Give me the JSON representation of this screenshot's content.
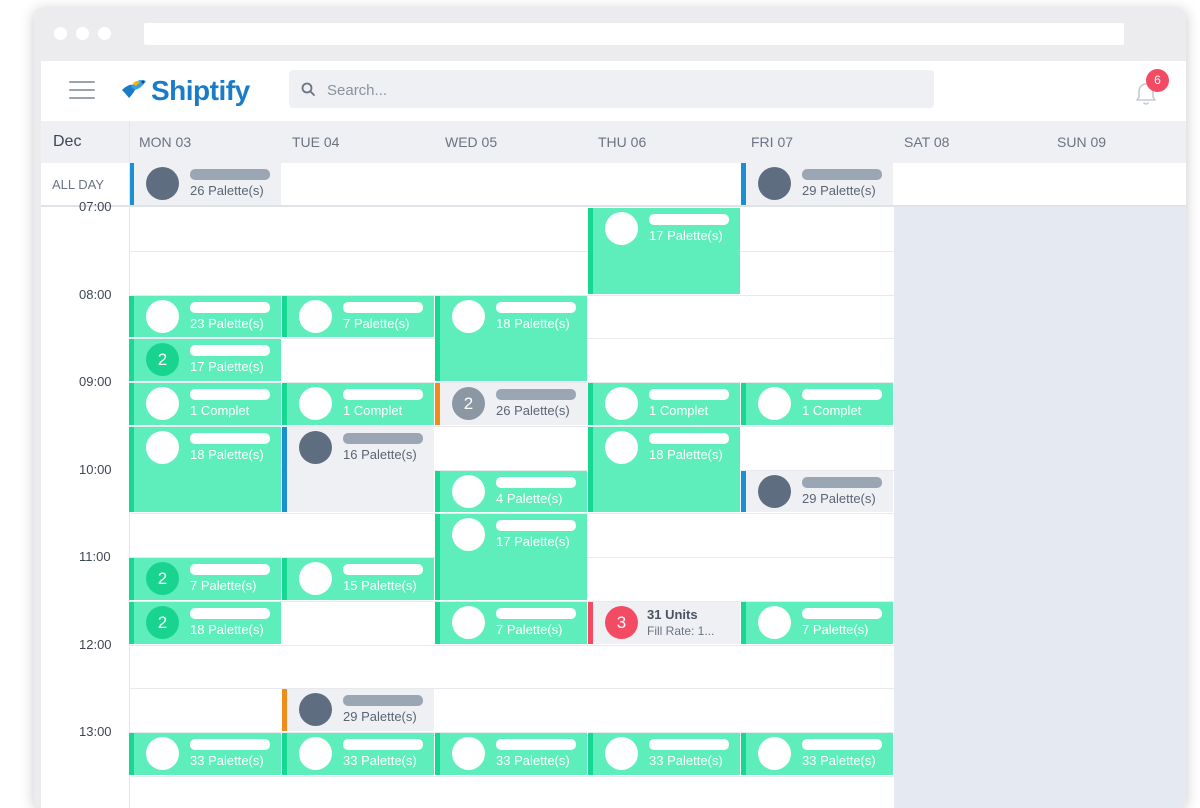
{
  "app": {
    "logo_text": "Shiptify",
    "search_placeholder": "Search...",
    "notifications_count": "6"
  },
  "calendar": {
    "month": "Dec",
    "all_day_label": "ALL DAY",
    "days": [
      "MON 03",
      "TUE 04",
      "WED 05",
      "THU 06",
      "FRI 07",
      "SAT 08",
      "SUN 09"
    ],
    "times": [
      "07:00",
      "08:00",
      "09:00",
      "10:00",
      "11:00",
      "12:00",
      "13:00"
    ],
    "all_day_events": [
      {
        "day": 0,
        "label": "26 Palette(s)"
      },
      {
        "day": 4,
        "label": "29 Palette(s)"
      }
    ],
    "events": [
      {
        "day": 3,
        "start": "07:00",
        "end": "08:00",
        "label": "17 Palette(s)"
      },
      {
        "day": 0,
        "start": "08:00",
        "end": "08:30",
        "label": "23 Palette(s)"
      },
      {
        "day": 1,
        "start": "08:00",
        "end": "08:30",
        "label": "7 Palette(s)"
      },
      {
        "day": 2,
        "start": "08:00",
        "end": "09:00",
        "label": "18 Palette(s)"
      },
      {
        "day": 0,
        "start": "08:30",
        "end": "09:00",
        "label": "17 Palette(s)",
        "count": "2"
      },
      {
        "day": 0,
        "start": "09:00",
        "end": "09:30",
        "label": "1 Complet"
      },
      {
        "day": 1,
        "start": "09:00",
        "end": "09:30",
        "label": "1 Complet"
      },
      {
        "day": 2,
        "start": "09:00",
        "end": "09:30",
        "label": "26 Palette(s)",
        "count": "2",
        "state": "pending"
      },
      {
        "day": 3,
        "start": "09:00",
        "end": "09:30",
        "label": "1 Complet"
      },
      {
        "day": 4,
        "start": "09:00",
        "end": "09:30",
        "label": "1 Complet"
      },
      {
        "day": 0,
        "start": "09:30",
        "end": "10:30",
        "label": "18 Palette(s)"
      },
      {
        "day": 1,
        "start": "09:30",
        "end": "10:30",
        "label": "16 Palette(s)",
        "state": "info"
      },
      {
        "day": 3,
        "start": "09:30",
        "end": "10:30",
        "label": "18 Palette(s)"
      },
      {
        "day": 2,
        "start": "10:00",
        "end": "10:30",
        "label": "4 Palette(s)"
      },
      {
        "day": 4,
        "start": "10:00",
        "end": "10:30",
        "label": "29 Palette(s)",
        "state": "info"
      },
      {
        "day": 2,
        "start": "10:30",
        "end": "11:30",
        "label": "17 Palette(s)"
      },
      {
        "day": 0,
        "start": "11:00",
        "end": "11:30",
        "label": "7 Palette(s)",
        "count": "2"
      },
      {
        "day": 1,
        "start": "11:00",
        "end": "11:30",
        "label": "15 Palette(s)"
      },
      {
        "day": 0,
        "start": "11:30",
        "end": "12:00",
        "label": "18 Palette(s)",
        "count": "2"
      },
      {
        "day": 2,
        "start": "11:30",
        "end": "12:00",
        "label": "7 Palette(s)"
      },
      {
        "day": 3,
        "start": "11:30",
        "end": "12:00",
        "title": "31 Units",
        "subtitle": "Fill Rate: 1...",
        "count": "3",
        "state": "alert"
      },
      {
        "day": 4,
        "start": "11:30",
        "end": "12:00",
        "label": "7 Palette(s)"
      },
      {
        "day": 1,
        "start": "12:30",
        "end": "13:00",
        "label": "29 Palette(s)",
        "state": "pending"
      },
      {
        "day": 0,
        "start": "13:00",
        "end": "13:30",
        "label": "33 Palette(s)"
      },
      {
        "day": 1,
        "start": "13:00",
        "end": "13:30",
        "label": "33 Palette(s)"
      },
      {
        "day": 2,
        "start": "13:00",
        "end": "13:30",
        "label": "33 Palette(s)"
      },
      {
        "day": 3,
        "start": "13:00",
        "end": "13:30",
        "label": "33 Palette(s)"
      },
      {
        "day": 4,
        "start": "13:00",
        "end": "13:30",
        "label": "33 Palette(s)"
      }
    ]
  },
  "colors": {
    "brand": "#1a7cc9",
    "event_green": "#5deebc",
    "event_green_stripe": "#16d892",
    "alert": "#f24b63",
    "pending": "#f08c1b",
    "info": "#1a8fd6"
  }
}
